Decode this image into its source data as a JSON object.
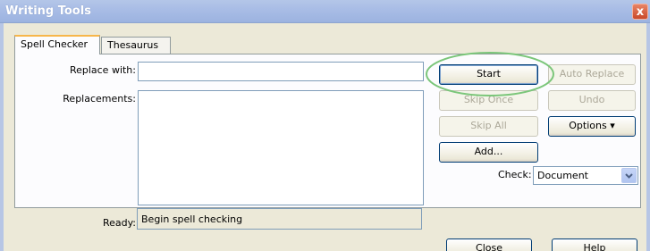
{
  "window": {
    "title": "Writing Tools",
    "close_glyph": "x"
  },
  "tabs": [
    {
      "label": "Spell Checker",
      "active": true
    },
    {
      "label": "Thesaurus",
      "active": false
    }
  ],
  "form": {
    "replace_with_label": "Replace with:",
    "replace_with_value": "",
    "replacements_label": "Replacements:",
    "ready_label": "Ready:",
    "ready_value": "Begin spell checking",
    "check_label": "Check:",
    "check_value": "Document"
  },
  "buttons": {
    "start": "Start",
    "auto_replace": "Auto Replace",
    "skip_once": "Skip Once",
    "undo": "Undo",
    "skip_all": "Skip All",
    "options": "Options ▾",
    "add": "Add...",
    "close": "Close",
    "help": "Help"
  },
  "annotation": {
    "highlight_color": "#7bc67a",
    "highlights": "start-button"
  },
  "colors": {
    "title_bar": "#a9bde6",
    "window_bg": "#ece9d8",
    "tab_accent": "#f7b64a",
    "button_border": "#003c74"
  },
  "icons": {
    "check_dropdown": "chevron-down-icon",
    "window_close": "close-icon"
  }
}
